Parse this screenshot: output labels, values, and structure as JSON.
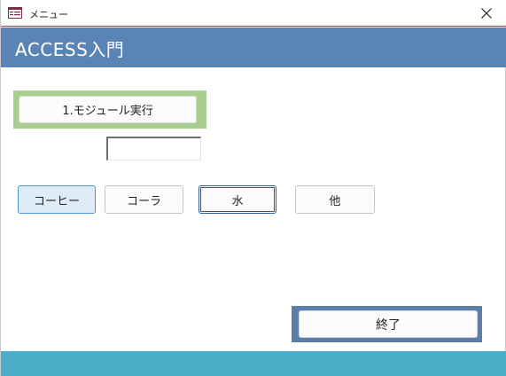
{
  "window": {
    "title": "メニュー",
    "form_icon": "form-icon",
    "close_icon": "close-icon"
  },
  "header": {
    "title": "ACCESS入門"
  },
  "buttons": {
    "run_module": "1.モジュール実行",
    "coffee": "コーヒー",
    "cola": "コーラ",
    "water": "水",
    "other": "他",
    "exit": "終了"
  },
  "result_field": {
    "value": ""
  },
  "colors": {
    "header_band": "#5b84b6",
    "footer_band": "#4aaec8",
    "green_frame": "#a8cf8f",
    "exit_frame": "#5b7fa8",
    "selected_button": "#dfecf8"
  }
}
